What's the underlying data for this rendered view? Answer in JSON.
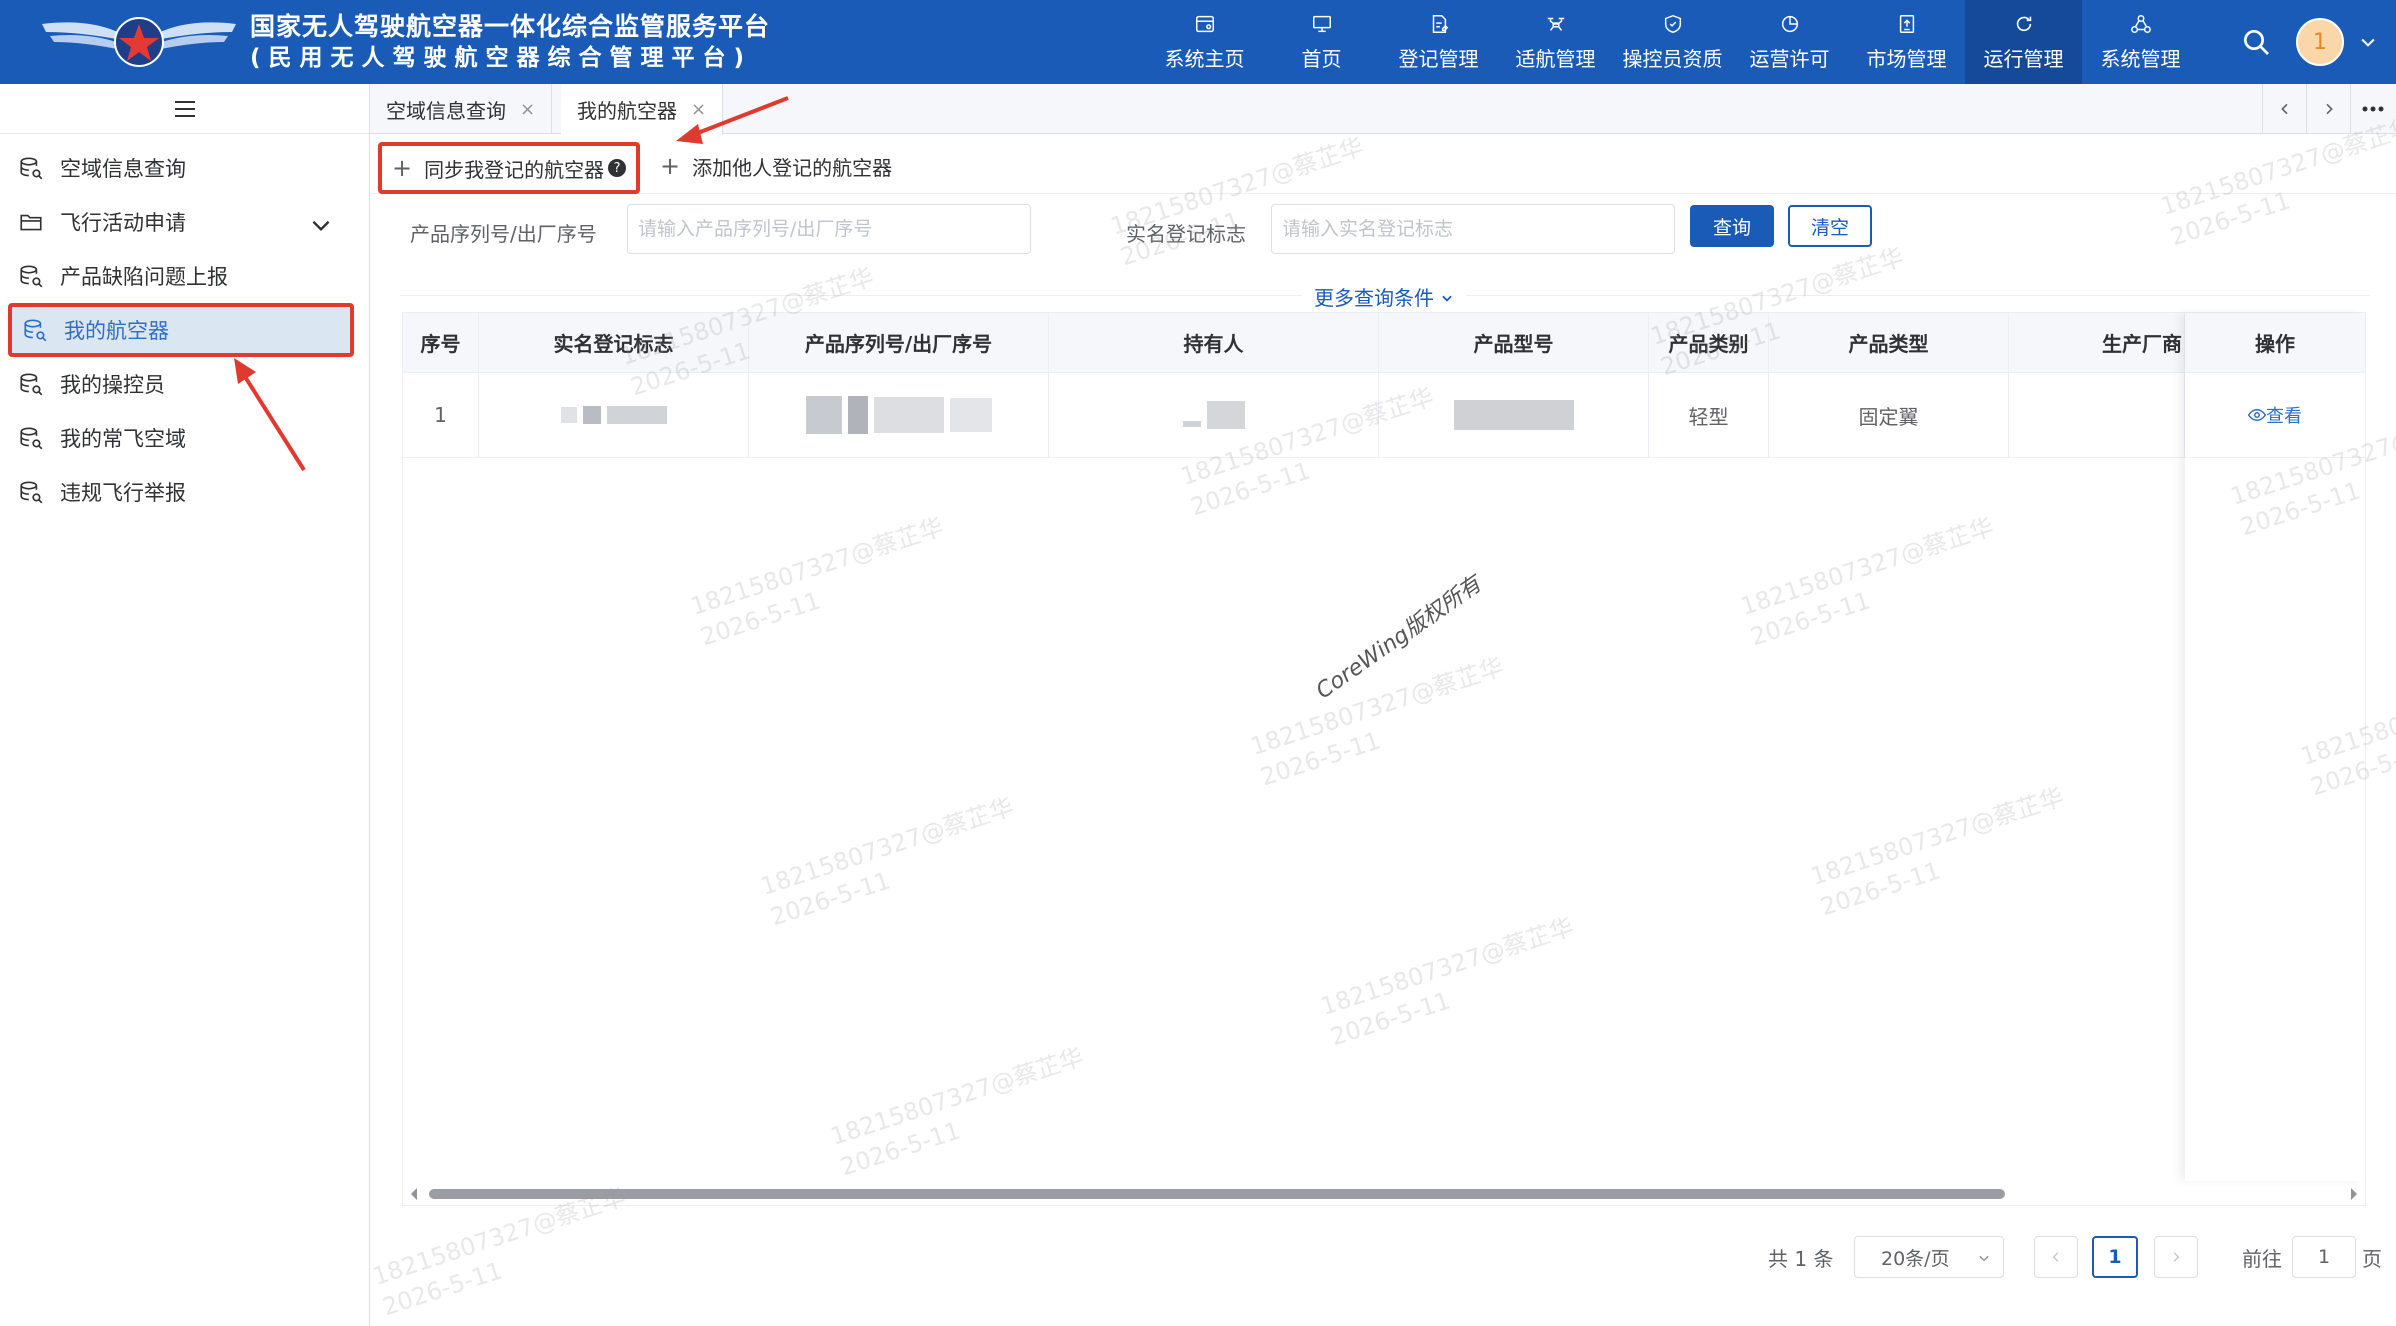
{
  "header": {
    "title_line1": "国家无人驾驶航空器一体化综合监管服务平台",
    "title_line2": "(民用无人驾驶航空器综合管理平台)",
    "nav": [
      {
        "label": "系统主页",
        "icon": "browser-icon"
      },
      {
        "label": "首页",
        "icon": "monitor-icon"
      },
      {
        "label": "登记管理",
        "icon": "document-edit-icon"
      },
      {
        "label": "适航管理",
        "icon": "drone-icon"
      },
      {
        "label": "操控员资质",
        "icon": "shield-icon"
      },
      {
        "label": "运营许可",
        "icon": "pie-chart-icon"
      },
      {
        "label": "市场管理",
        "icon": "upload-doc-icon"
      },
      {
        "label": "运行管理",
        "icon": "refresh-icon",
        "active": true
      },
      {
        "label": "系统管理",
        "icon": "network-icon"
      }
    ],
    "avatar_text": "1",
    "accent": "#1a5bb8"
  },
  "sidebar": {
    "items": [
      {
        "label": "空域信息查询"
      },
      {
        "label": "飞行活动申请",
        "expandable": true
      },
      {
        "label": "产品缺陷问题上报"
      },
      {
        "label": "我的航空器",
        "active": true
      },
      {
        "label": "我的操控员"
      },
      {
        "label": "我的常飞空域"
      },
      {
        "label": "违规飞行举报"
      }
    ]
  },
  "tabs": [
    {
      "label": "空域信息查询",
      "close": "×"
    },
    {
      "label": "我的航空器",
      "close": "×",
      "active": true
    }
  ],
  "toolbar": {
    "sync_label": "同步我登记的航空器",
    "add_label": "添加他人登记的航空器",
    "help_glyph": "?"
  },
  "filters": {
    "serial_label": "产品序列号/出厂序号",
    "serial_placeholder": "请输入产品序列号/出厂序号",
    "realname_label": "实名登记标志",
    "realname_placeholder": "请输入实名登记标志",
    "query_label": "查询",
    "clear_label": "清空",
    "more_label": "更多查询条件"
  },
  "table": {
    "columns": [
      "序号",
      "实名登记标志",
      "产品序列号/出厂序号",
      "持有人",
      "产品型号",
      "产品类别",
      "产品类型",
      "生产厂商",
      "操作"
    ],
    "rows": [
      {
        "index": "1",
        "category": "轻型",
        "type": "固定翼",
        "action": "查看"
      }
    ]
  },
  "pagination": {
    "total": "共 1 条",
    "page_size": "20条/页",
    "current_page": "1",
    "goto_prefix": "前往",
    "goto_value": "1",
    "goto_suffix": "页"
  },
  "watermark": {
    "text1": "18215807327@蔡芷华",
    "text2": "2026-5-11",
    "copyright": "CoreWing版权所有"
  },
  "annotation_color": "#e03a2f"
}
